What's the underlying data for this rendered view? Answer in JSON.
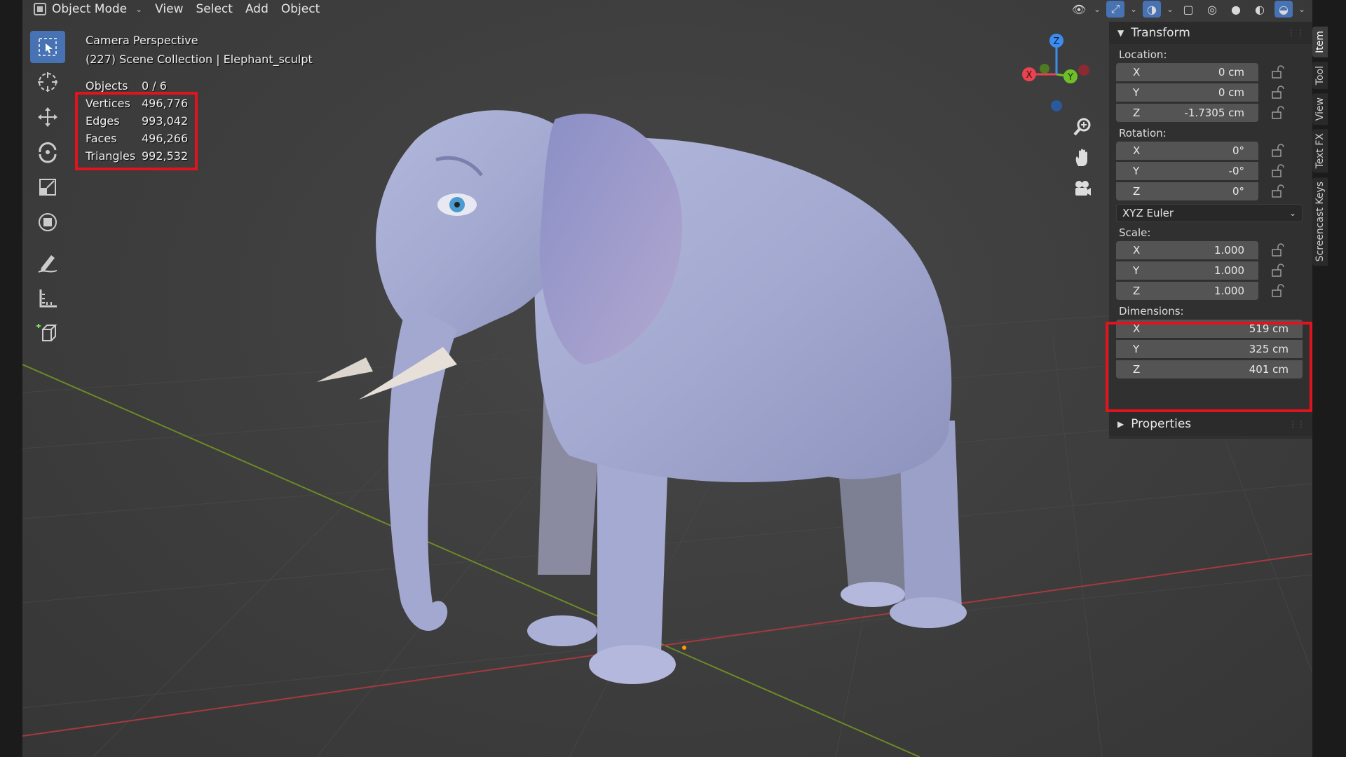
{
  "header": {
    "mode_label": "Object Mode",
    "menus": [
      "View",
      "Select",
      "Add",
      "Object"
    ]
  },
  "overlay": {
    "view_name": "Camera Perspective",
    "collection": "(227) Scene Collection | Elephant_sculpt"
  },
  "stats": [
    {
      "label": "Objects",
      "value": "0 / 6"
    },
    {
      "label": "Vertices",
      "value": "496,776"
    },
    {
      "label": "Edges",
      "value": "993,042"
    },
    {
      "label": "Faces",
      "value": "496,266"
    },
    {
      "label": "Triangles",
      "value": "992,532"
    }
  ],
  "toolbar": {
    "tools": [
      "select-box-tool",
      "cursor-tool",
      "move-tool",
      "rotate-tool",
      "scale-tool",
      "transform-tool",
      "annotate-tool",
      "measure-tool",
      "add-cube-tool"
    ]
  },
  "gizmo": {
    "x": "X",
    "y": "Y",
    "z": "Z"
  },
  "npanel": {
    "transform_title": "Transform",
    "location_label": "Location:",
    "location": [
      {
        "axis": "X",
        "value": "0 cm"
      },
      {
        "axis": "Y",
        "value": "0 cm"
      },
      {
        "axis": "Z",
        "value": "-1.7305 cm"
      }
    ],
    "rotation_label": "Rotation:",
    "rotation": [
      {
        "axis": "X",
        "value": "0°"
      },
      {
        "axis": "Y",
        "value": "-0°"
      },
      {
        "axis": "Z",
        "value": "0°"
      }
    ],
    "rotation_mode": "XYZ Euler",
    "scale_label": "Scale:",
    "scale": [
      {
        "axis": "X",
        "value": "1.000"
      },
      {
        "axis": "Y",
        "value": "1.000"
      },
      {
        "axis": "Z",
        "value": "1.000"
      }
    ],
    "dimensions_label": "Dimensions:",
    "dimensions": [
      {
        "axis": "X",
        "value": "519 cm"
      },
      {
        "axis": "Y",
        "value": "325 cm"
      },
      {
        "axis": "Z",
        "value": "401 cm"
      }
    ],
    "properties_title": "Properties"
  },
  "tabs": [
    "Item",
    "Tool",
    "View",
    "Text FX",
    "Screencast Keys"
  ],
  "colors": {
    "accent": "#4772b3",
    "highlight_box": "#e0131e",
    "axis_x": "#e8434f",
    "axis_y": "#6fbf2a",
    "axis_z": "#3d8df0",
    "model": "#a6acd3"
  }
}
